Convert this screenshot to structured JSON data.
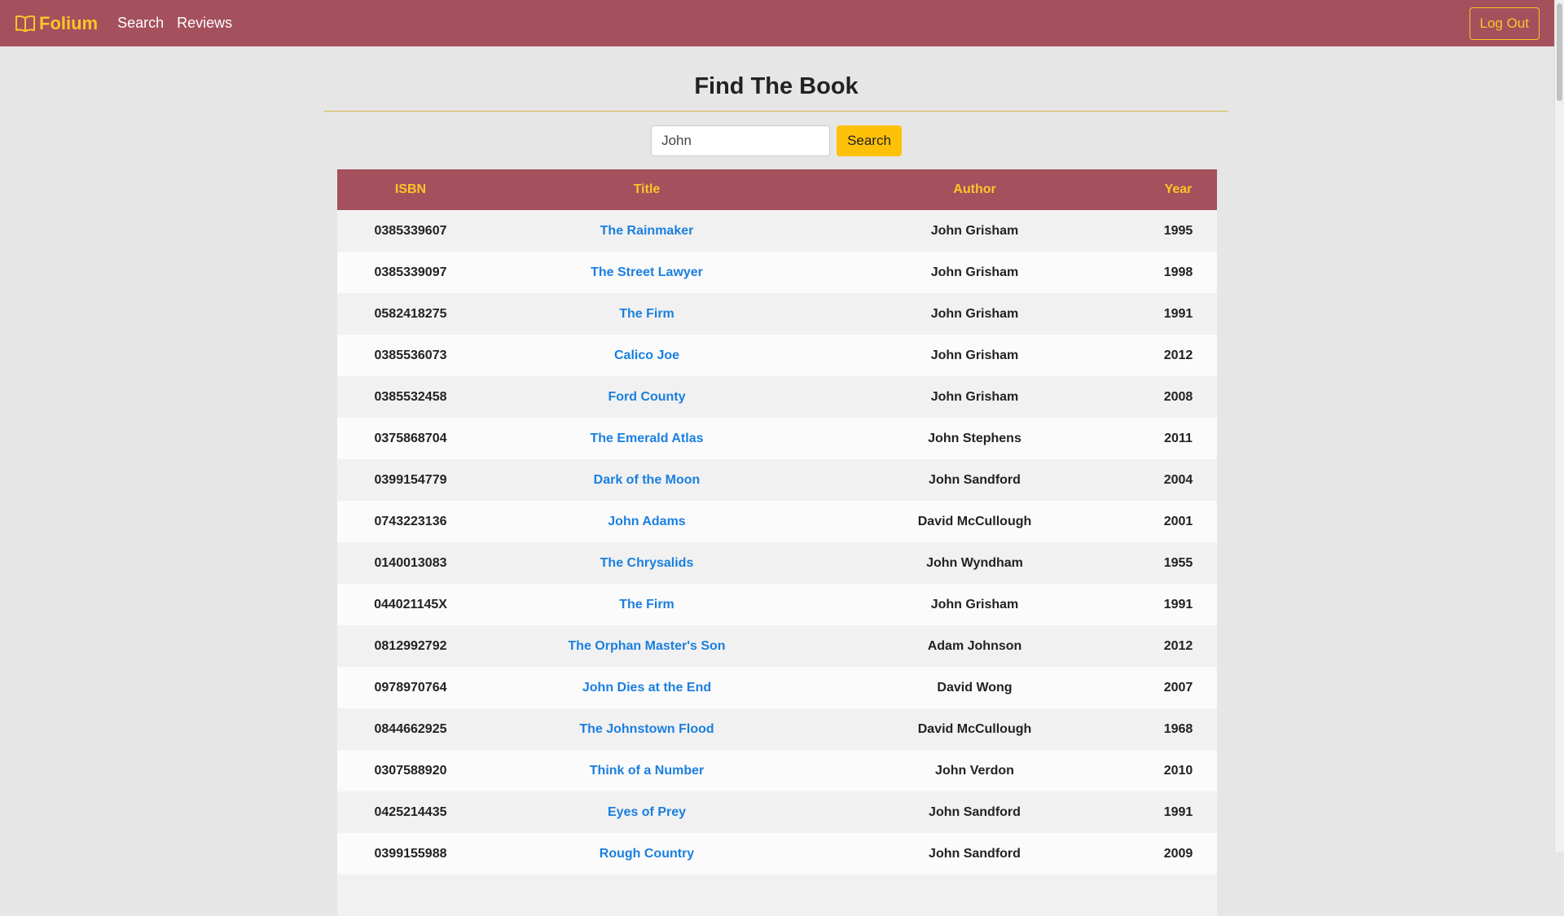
{
  "nav": {
    "brand": "Folium",
    "links": [
      "Search",
      "Reviews"
    ],
    "logout": "Log Out",
    "colors": {
      "bar": "#a4505d",
      "accent": "#ffc428"
    }
  },
  "page": {
    "title": "Find The Book"
  },
  "search": {
    "value": "John",
    "button": "Search"
  },
  "table": {
    "headers": [
      "ISBN",
      "Title",
      "Author",
      "Year"
    ],
    "rows": [
      {
        "isbn": "0385339607",
        "title": "The Rainmaker",
        "author": "John Grisham",
        "year": "1995"
      },
      {
        "isbn": "0385339097",
        "title": "The Street Lawyer",
        "author": "John Grisham",
        "year": "1998"
      },
      {
        "isbn": "0582418275",
        "title": "The Firm",
        "author": "John Grisham",
        "year": "1991"
      },
      {
        "isbn": "0385536073",
        "title": "Calico Joe",
        "author": "John Grisham",
        "year": "2012"
      },
      {
        "isbn": "0385532458",
        "title": "Ford County",
        "author": "John Grisham",
        "year": "2008"
      },
      {
        "isbn": "0375868704",
        "title": "The Emerald Atlas",
        "author": "John Stephens",
        "year": "2011"
      },
      {
        "isbn": "0399154779",
        "title": "Dark of the Moon",
        "author": "John Sandford",
        "year": "2004"
      },
      {
        "isbn": "0743223136",
        "title": "John Adams",
        "author": "David McCullough",
        "year": "2001"
      },
      {
        "isbn": "0140013083",
        "title": "The Chrysalids",
        "author": "John Wyndham",
        "year": "1955"
      },
      {
        "isbn": "044021145X",
        "title": "The Firm",
        "author": "John Grisham",
        "year": "1991"
      },
      {
        "isbn": "0812992792",
        "title": "The Orphan Master's Son",
        "author": "Adam Johnson",
        "year": "2012"
      },
      {
        "isbn": "0978970764",
        "title": "John Dies at the End",
        "author": "David Wong",
        "year": "2007"
      },
      {
        "isbn": "0844662925",
        "title": "The Johnstown Flood",
        "author": "David McCullough",
        "year": "1968"
      },
      {
        "isbn": "0307588920",
        "title": "Think of a Number",
        "author": "John Verdon",
        "year": "2010"
      },
      {
        "isbn": "0425214435",
        "title": "Eyes of Prey",
        "author": "John Sandford",
        "year": "1991"
      },
      {
        "isbn": "0399155988",
        "title": "Rough Country",
        "author": "John Sandford",
        "year": "2009"
      },
      {
        "isbn": "",
        "title": "",
        "author": "",
        "year": ""
      }
    ]
  }
}
